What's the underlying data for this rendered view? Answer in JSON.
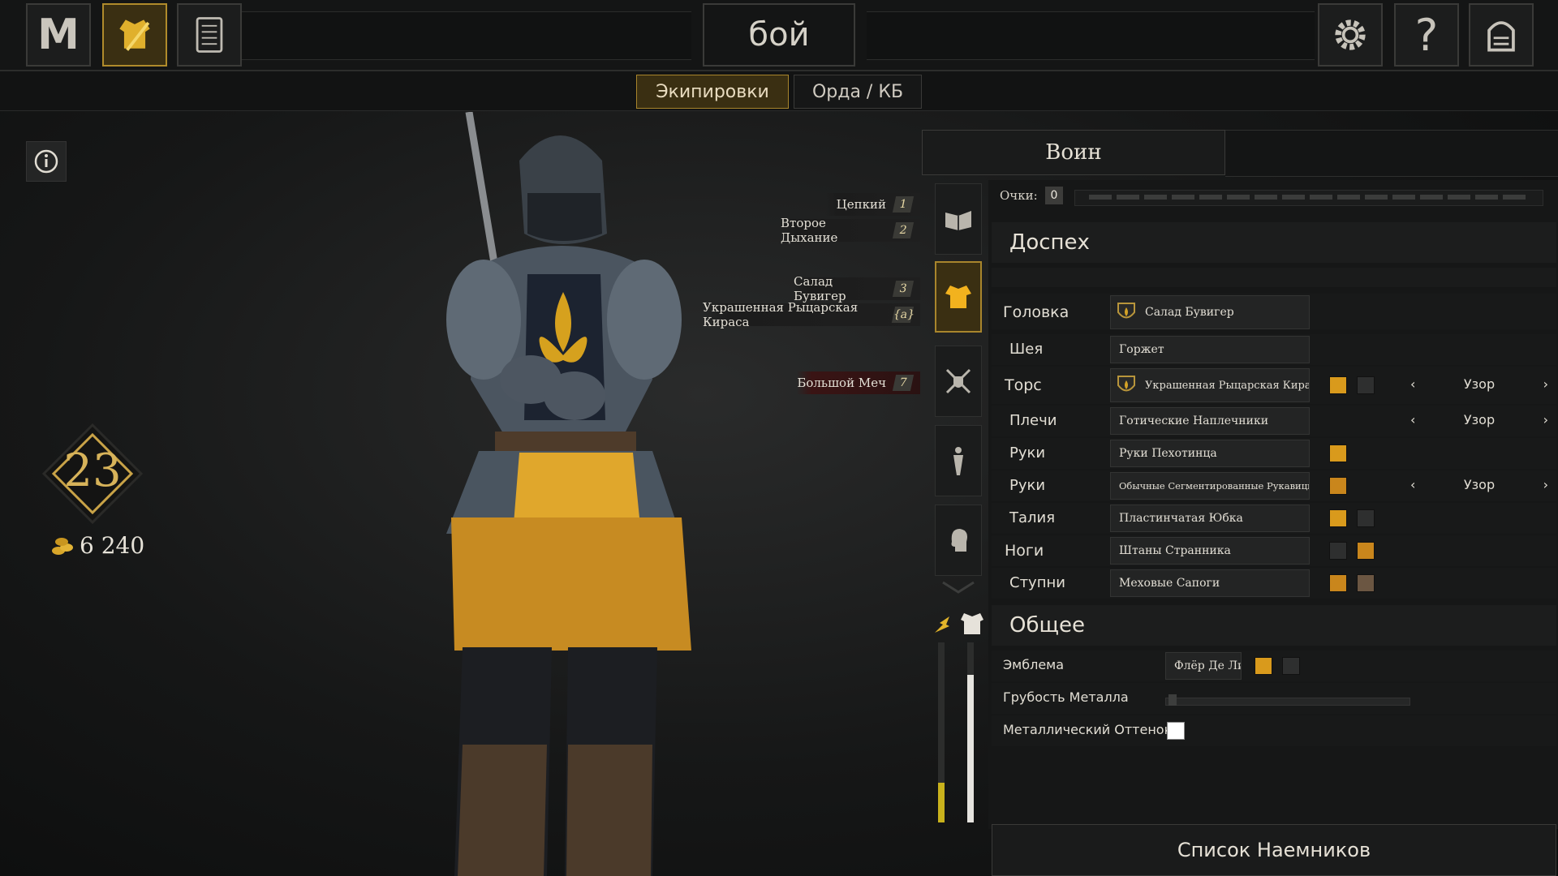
{
  "topbar": {
    "logo_letter": "M",
    "mode_title": "бой",
    "buttons": [
      "menu-logo",
      "equipment-icon",
      "scroll-icon",
      "gear-icon",
      "help-icon",
      "exit-door-icon"
    ],
    "help_glyph": "?"
  },
  "tabs": [
    {
      "label": "Экипировки",
      "active": true
    },
    {
      "label": "Орда / КБ",
      "active": false
    }
  ],
  "player": {
    "level": "23",
    "gold": "6 240"
  },
  "perks": [
    {
      "name": "Цепкий",
      "slot": "1"
    },
    {
      "name": "Второе Дыхание",
      "slot": "2"
    },
    {
      "name": "Салад Бувигер",
      "slot": "3"
    },
    {
      "name": "Украшенная Рыцарская Кираса",
      "slot": "{a}"
    },
    {
      "name": "Большой Меч",
      "slot": "7"
    }
  ],
  "loadout": {
    "class_name": "Воин",
    "points_label": "Очки:",
    "points_value": "0"
  },
  "armor": {
    "title": "Доспех",
    "rows": [
      {
        "label": "Головка",
        "item": "Салад Бувигер",
        "pattern": ""
      },
      {
        "label": "Шея",
        "item": "Горжет",
        "pattern": ""
      },
      {
        "label": "Торс",
        "item": "Украшенная Рыцарская Кираса",
        "pattern": "Узор"
      },
      {
        "label": "Плечи",
        "item": "Готические Наплечники",
        "pattern": "Узор"
      },
      {
        "label": "Руки",
        "item": "Руки Пехотинца",
        "pattern": ""
      },
      {
        "label": "Руки",
        "item": "Обычные Сегментированные Рукавицы",
        "pattern": "Узор"
      },
      {
        "label": "Талия",
        "item": "Пластинчатая Юбка",
        "pattern": ""
      },
      {
        "label": "Ноги",
        "item": "Штаны Странника",
        "pattern": ""
      },
      {
        "label": "Ступни",
        "item": "Меховые Сапоги",
        "pattern": ""
      }
    ]
  },
  "general": {
    "title": "Общее",
    "emblem_label": "Эмблема",
    "emblem_value": "Флёр Де Лис",
    "roughness_label": "Грубость Металла",
    "tint_label": "Металлический Оттенок"
  },
  "mercenary_button": "Список Наемников",
  "colors": {
    "accent_gold": "#d99a1c",
    "dark_swatch": "#2e2f2f",
    "brown_swatch": "#6b5642",
    "active_border": "#a8852c",
    "stamina_fill": "#c9b21c"
  }
}
